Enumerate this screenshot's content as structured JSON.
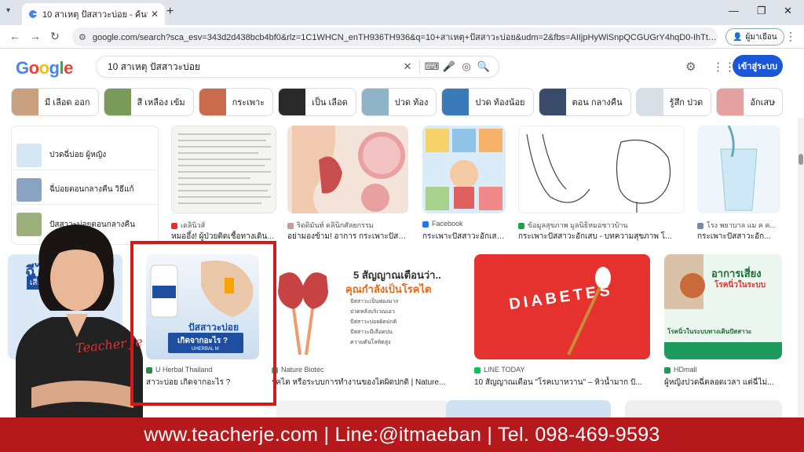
{
  "browser": {
    "tab_title": "10 สาเหตุ ปัสสาวะบ่อย - ค้นหาด้วย Google",
    "url": "google.com/search?sca_esv=343d2d438bcb4bf0&rlz=1C1WHCN_enTH936TH936&q=10+สาเหตุ+ปัสสาวะบ่อย&udm=2&fbs=AIIjpHyWiSnpQCGUGrY4hqD0-IhTtLK0wygK...",
    "profile_label": "ผู้มาเยือน"
  },
  "search": {
    "logo": "Google",
    "query": "10 สาเหตุ ปัสสาวะบ่อย",
    "signin_label": "เข้าสู่ระบบ"
  },
  "chips": [
    {
      "label": "มี เลือด ออก",
      "color": "#c9a080"
    },
    {
      "label": "สี เหลือง เข้ม",
      "color": "#7a9a5a"
    },
    {
      "label": "กระเพาะ",
      "color": "#c96a4a"
    },
    {
      "label": "เป็น เลือด",
      "color": "#2a2a2a"
    },
    {
      "label": "ปวด ท้อง",
      "color": "#8fb3c9"
    },
    {
      "label": "ปวด ท้องน้อย",
      "color": "#3a7ab8"
    },
    {
      "label": "ตอน กลางคืน",
      "color": "#3a4a6a"
    },
    {
      "label": "รู้สึก ปวด",
      "color": "#d9dfe6"
    },
    {
      "label": "อักเสบ",
      "color": "#e5a0a0"
    }
  ],
  "related": [
    {
      "label": "ปวดฉี่บ่อย ผู้หญิง"
    },
    {
      "label": "ฉี่บ่อยตอนกลางคืน วิธีแก้"
    },
    {
      "label": "ปัสสาวะบ่อยตอนกลางคืน"
    }
  ],
  "row1": [
    {
      "source": "เดลินิวส์",
      "caption": "หมออึ้ง! ผู้ป่วยติดเชื้อทางเดิน..."
    },
    {
      "source": "ริดดิมันท์ คลินิกศัลยกรรม",
      "caption": "อย่ามองข้าม! อาการ กระเพาะปัสสาวะ..."
    },
    {
      "source": "Facebook",
      "caption": "กระเพาะปัสสาวะอักเสบ..."
    },
    {
      "source": "ข้อมูลสุขภาพ มูลนิธิหมอชาวบ้าน",
      "caption": "กระเพาะปัสสาวะอักเสบ - บทความสุขภาพ โ..."
    },
    {
      "source": "โรง พยาบาล แม ค ค...",
      "caption": "กระเพาะปัสสาวะอัก..."
    }
  ],
  "row2": [
    {
      "source": "U Herbal Thailand",
      "caption": "สาวะบ่อย เกิดจากอะไร ?",
      "image_title": "ปัสสาวะบ่อย",
      "image_sub": "เกิดจากอะไร ?",
      "brand": "UHERBAL M"
    },
    {
      "source": "Nature Biotec",
      "caption": "รคไต หรือระบบการทำงานของไตผิดปกติ | Nature...",
      "headline_1": "5 สัญญาณเตือนว่า..",
      "headline_2": "คุณกำลังเป็นโรคไต",
      "bullets": [
        "ปัสสาวะเป็นฟองมาก",
        "ปวดหลังบริเวณเอว",
        "ปัสสาวะบ่อยผิดปกติ",
        "ปัสสาวะมีเลือดปน",
        "ความดันโลหิตสูง"
      ]
    },
    {
      "source": "LINE TODAY",
      "caption": "10 สัญญาณเตือน \"โรคเบาหวาน\" – หิวน้ำมาก ปั...",
      "word": "DIABETES"
    },
    {
      "source": "HDmall",
      "caption": "ผู้หญิงปวดฉี่ตลอดเวลา แต่ฉี่ไม่...",
      "headline": "อาการเสี่ยง",
      "sub": "โรคนิ่วในระบบ",
      "footer": "โรคนิ่วในระบบทางเดินปัสสาวะ"
    }
  ],
  "overlay": {
    "left_text_1": "ฉีไม่ส",
    "left_text_2": "เสี่ยง",
    "signature": "Teacher Je",
    "banner": "www.teacherje.com | Line:@itmaeban | Tel. 098-469-9593"
  }
}
